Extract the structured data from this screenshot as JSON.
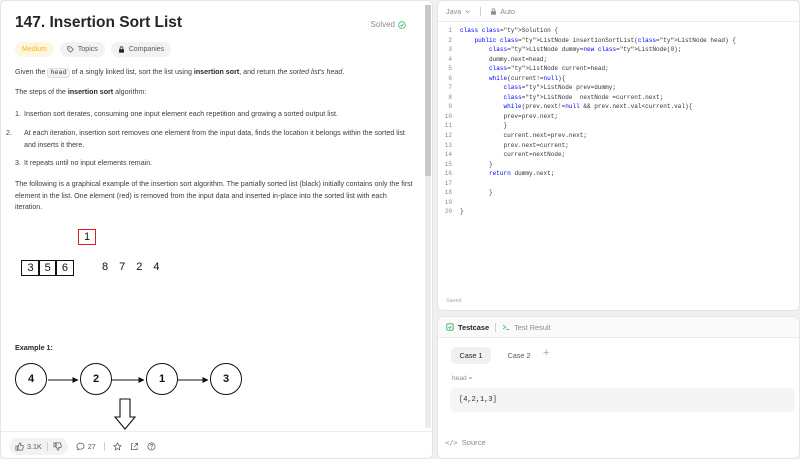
{
  "problem": {
    "title": "147. Insertion Sort List",
    "status": "Solved",
    "difficulty": "Medium",
    "topics_label": "Topics",
    "companies_label": "Companies"
  },
  "description": {
    "p1_pre": "Given the ",
    "p1_code": "head",
    "p1_mid": " of a singly linked list, sort the list using ",
    "p1_bold": "insertion sort",
    "p1_post": ", and return ",
    "p1_italic": "the sorted list's head",
    "p1_end": ".",
    "p2_pre": "The steps of the ",
    "p2_bold": "insertion sort",
    "p2_post": " algorithm:",
    "steps": [
      {
        "num": "1.",
        "text": "Insertion sort iterates, consuming one input element each repetition and growing a sorted output list."
      },
      {
        "num": "2.",
        "text": "At each iteration, insertion sort removes one element from the input data, finds the location it belongs within the sorted list and inserts it there."
      },
      {
        "num": "3.",
        "text": "It repeats until no input elements remain."
      }
    ],
    "p3": "The following is a graphical example of the insertion sort algorithm. The partially sorted list (black) initially contains only the first element in the list. One element (red) is removed from the input data and inserted in-place into the sorted list with each iteration."
  },
  "animation": {
    "current": "1",
    "sorted": [
      "3",
      "5",
      "6"
    ],
    "remaining": [
      "8",
      "7",
      "2",
      "4"
    ]
  },
  "example": {
    "title": "Example 1:",
    "nodes": [
      "4",
      "2",
      "1",
      "3"
    ]
  },
  "footer": {
    "likes": "3.1K",
    "comments": "27"
  },
  "editor": {
    "language": "Java",
    "mode": "Auto",
    "saved": "Saved",
    "lines": [
      {
        "n": "1",
        "code": "class Solution {"
      },
      {
        "n": "2",
        "code": "    public ListNode insertionSortList(ListNode head) {"
      },
      {
        "n": "3",
        "code": "        ListNode dummy=new ListNode(0);"
      },
      {
        "n": "4",
        "code": "        dummy.next=head;"
      },
      {
        "n": "5",
        "code": "        ListNode current=head;"
      },
      {
        "n": "6",
        "code": "        while(current!=null){"
      },
      {
        "n": "7",
        "code": "            ListNode prev=dummy;"
      },
      {
        "n": "8",
        "code": "            ListNode  nextNode =current.next;"
      },
      {
        "n": "9",
        "code": "            while(prev.next!=null && prev.next.val<current.val){"
      },
      {
        "n": "10",
        "code": "            prev=prev.next;"
      },
      {
        "n": "11",
        "code": "            }"
      },
      {
        "n": "12",
        "code": "            current.next=prev.next;"
      },
      {
        "n": "13",
        "code": "            prev.next=current;"
      },
      {
        "n": "14",
        "code": "            current=nextNode;"
      },
      {
        "n": "15",
        "code": "        }"
      },
      {
        "n": "16",
        "code": "        return dummy.next;"
      },
      {
        "n": "17",
        "code": ""
      },
      {
        "n": "18",
        "code": "        }"
      },
      {
        "n": "19",
        "code": ""
      },
      {
        "n": "20",
        "code": "}"
      }
    ]
  },
  "testpanel": {
    "tab_testcase": "Testcase",
    "tab_result": "Test Result",
    "cases": [
      "Case 1",
      "Case 2"
    ],
    "param_label": "head =",
    "param_value": "[4,2,1,3]",
    "source_label": "Source"
  },
  "colors": {
    "medium": "#ffb800",
    "solved": "#2db55d",
    "testcase_icon": "#2db55d",
    "red_box": "#e02020"
  }
}
